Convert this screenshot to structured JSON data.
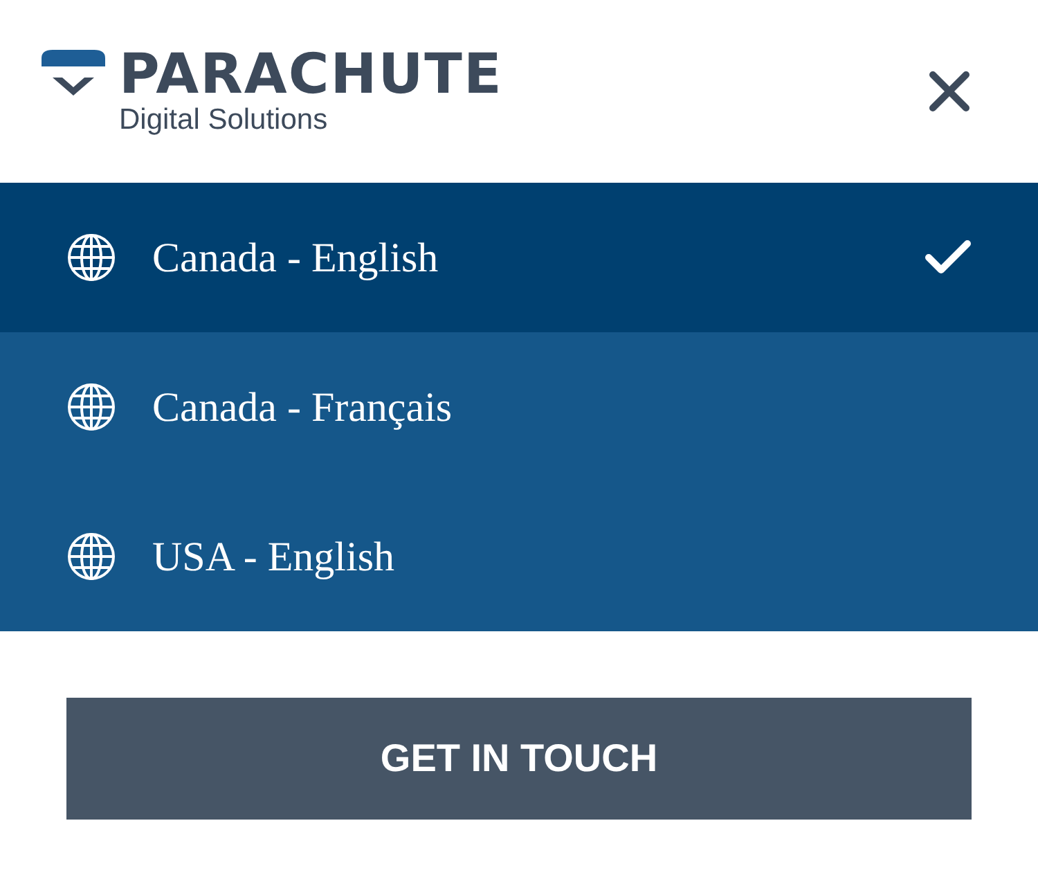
{
  "logo": {
    "name": "PARACHUTE",
    "tagline": "Digital Solutions"
  },
  "languages": [
    {
      "label": "Canada - English",
      "selected": true
    },
    {
      "label": "Canada - Français",
      "selected": false
    },
    {
      "label": "USA - English",
      "selected": false
    }
  ],
  "cta": {
    "label": "GET IN TOUCH"
  }
}
